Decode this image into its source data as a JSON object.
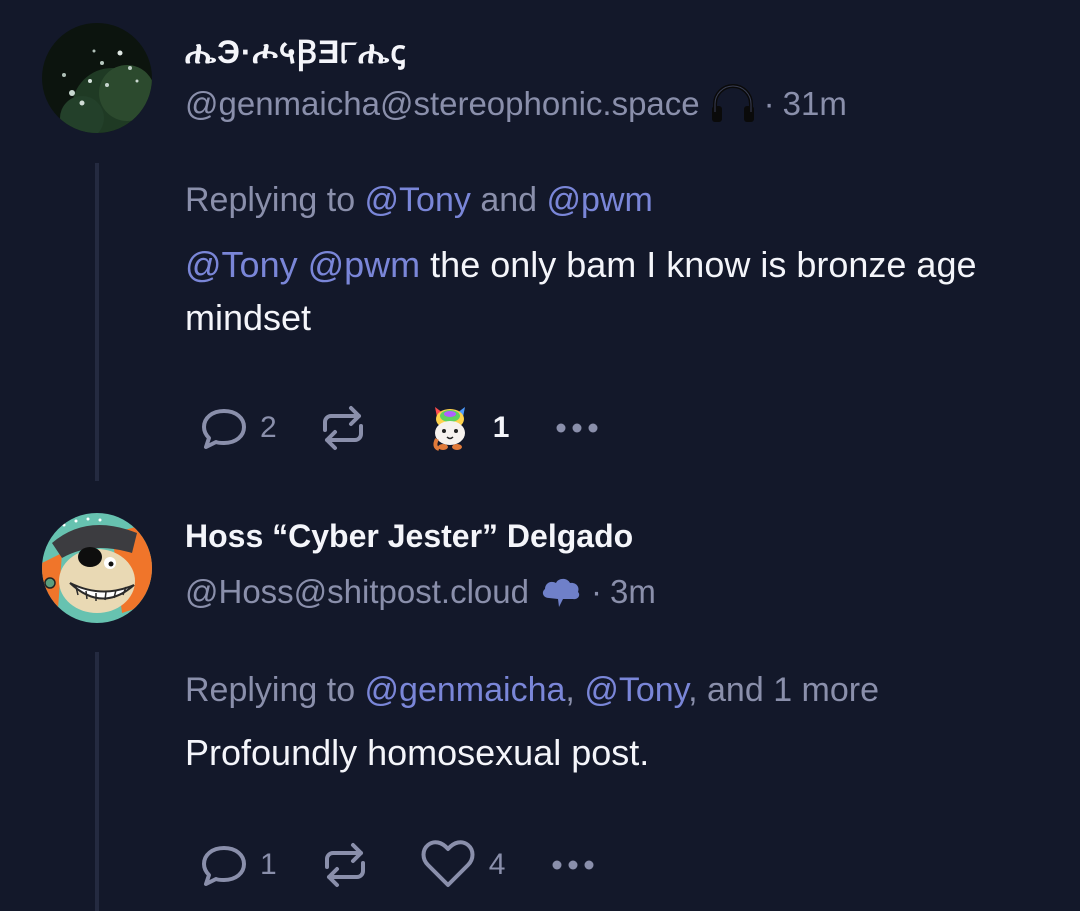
{
  "posts": [
    {
      "display_name": "ሔЭ·ሖ५ꞴƎ୮ሔꞔ",
      "handle": "@genmaicha@stereophonic.space",
      "server_icon": "headphones-icon",
      "dot": "·",
      "time": "31m",
      "reply": {
        "prefix": "Replying to ",
        "mention1": "@Tony",
        "joiner": " and ",
        "mention2": "@pwm"
      },
      "body": {
        "mention1": "@Tony",
        "space": " ",
        "mention2": "@pwm",
        "text": " the only bam I know is bronze age mindset"
      },
      "actions": {
        "reply_count": "2",
        "reaction_icon": "rainbow-cat-emoji-icon",
        "reaction_count": "1"
      }
    },
    {
      "display_name": "Hoss “Cyber Jester” Delgado",
      "handle": "@Hoss@shitpost.cloud",
      "server_icon": "cloud-icon",
      "dot": "·",
      "time": "3m",
      "reply": {
        "prefix": "Replying to ",
        "mention1": "@genmaicha",
        "sep": ", ",
        "mention2": "@Tony",
        "suffix": ", and 1 more"
      },
      "body": {
        "text": "Profoundly homosexual post."
      },
      "actions": {
        "reply_count": "1",
        "like_count": "4"
      }
    }
  ],
  "colors": {
    "background": "#13182a",
    "muted": "#8a8fab",
    "mention": "#7a86d8",
    "text": "#f4f5fa"
  }
}
